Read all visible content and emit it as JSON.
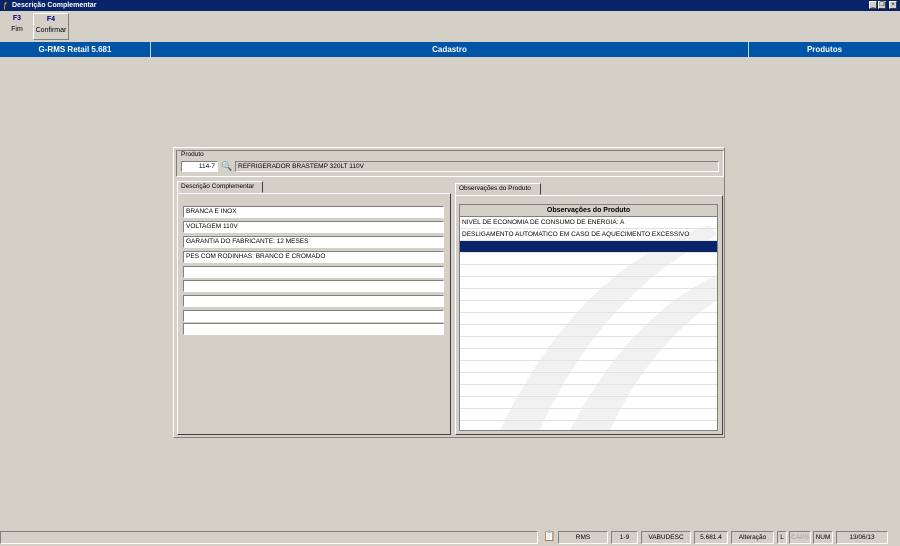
{
  "window": {
    "title": "Descrição Complementar"
  },
  "toolbar": {
    "buttons": [
      {
        "key": "F3",
        "label": "Fim"
      },
      {
        "key": "F4",
        "label": "Confirmar"
      }
    ]
  },
  "header": {
    "app": "G-RMS Retail 5.681",
    "section": "Cadastro",
    "module": "Produtos"
  },
  "produto": {
    "label": "Produto",
    "code": "114-7",
    "description": "REFRIGERADOR BRASTEMP 320LT 110V"
  },
  "descricao": {
    "tab_label": "Descrição Complementar",
    "lines": [
      "BRANCA E INOX",
      "VOLTAGEM 110V",
      "GARANTIA DO FABRICANTE: 12 MESES",
      "PES COM RODINHAS: BRANCO E CROMADO",
      "",
      "",
      "",
      "",
      "",
      ""
    ]
  },
  "observacoes": {
    "tab_label": "Observações do Produto",
    "column_header": "Observações do Produto",
    "rows": [
      "NIVEL DE ECONOMIA DE CONSUMO DE ENERGIA: A",
      "DESLIGAMENTO AUTOMATICO EM CASO DE AQUECIMENTO EXCESSIVO"
    ]
  },
  "status": {
    "system": "RMS",
    "company": "1-9",
    "program": "VABUDESC",
    "version": "5.681.4",
    "mode": "Alteração",
    "l": "L",
    "caps": "CAPS",
    "num": "NUM",
    "date": "13/06/13"
  }
}
